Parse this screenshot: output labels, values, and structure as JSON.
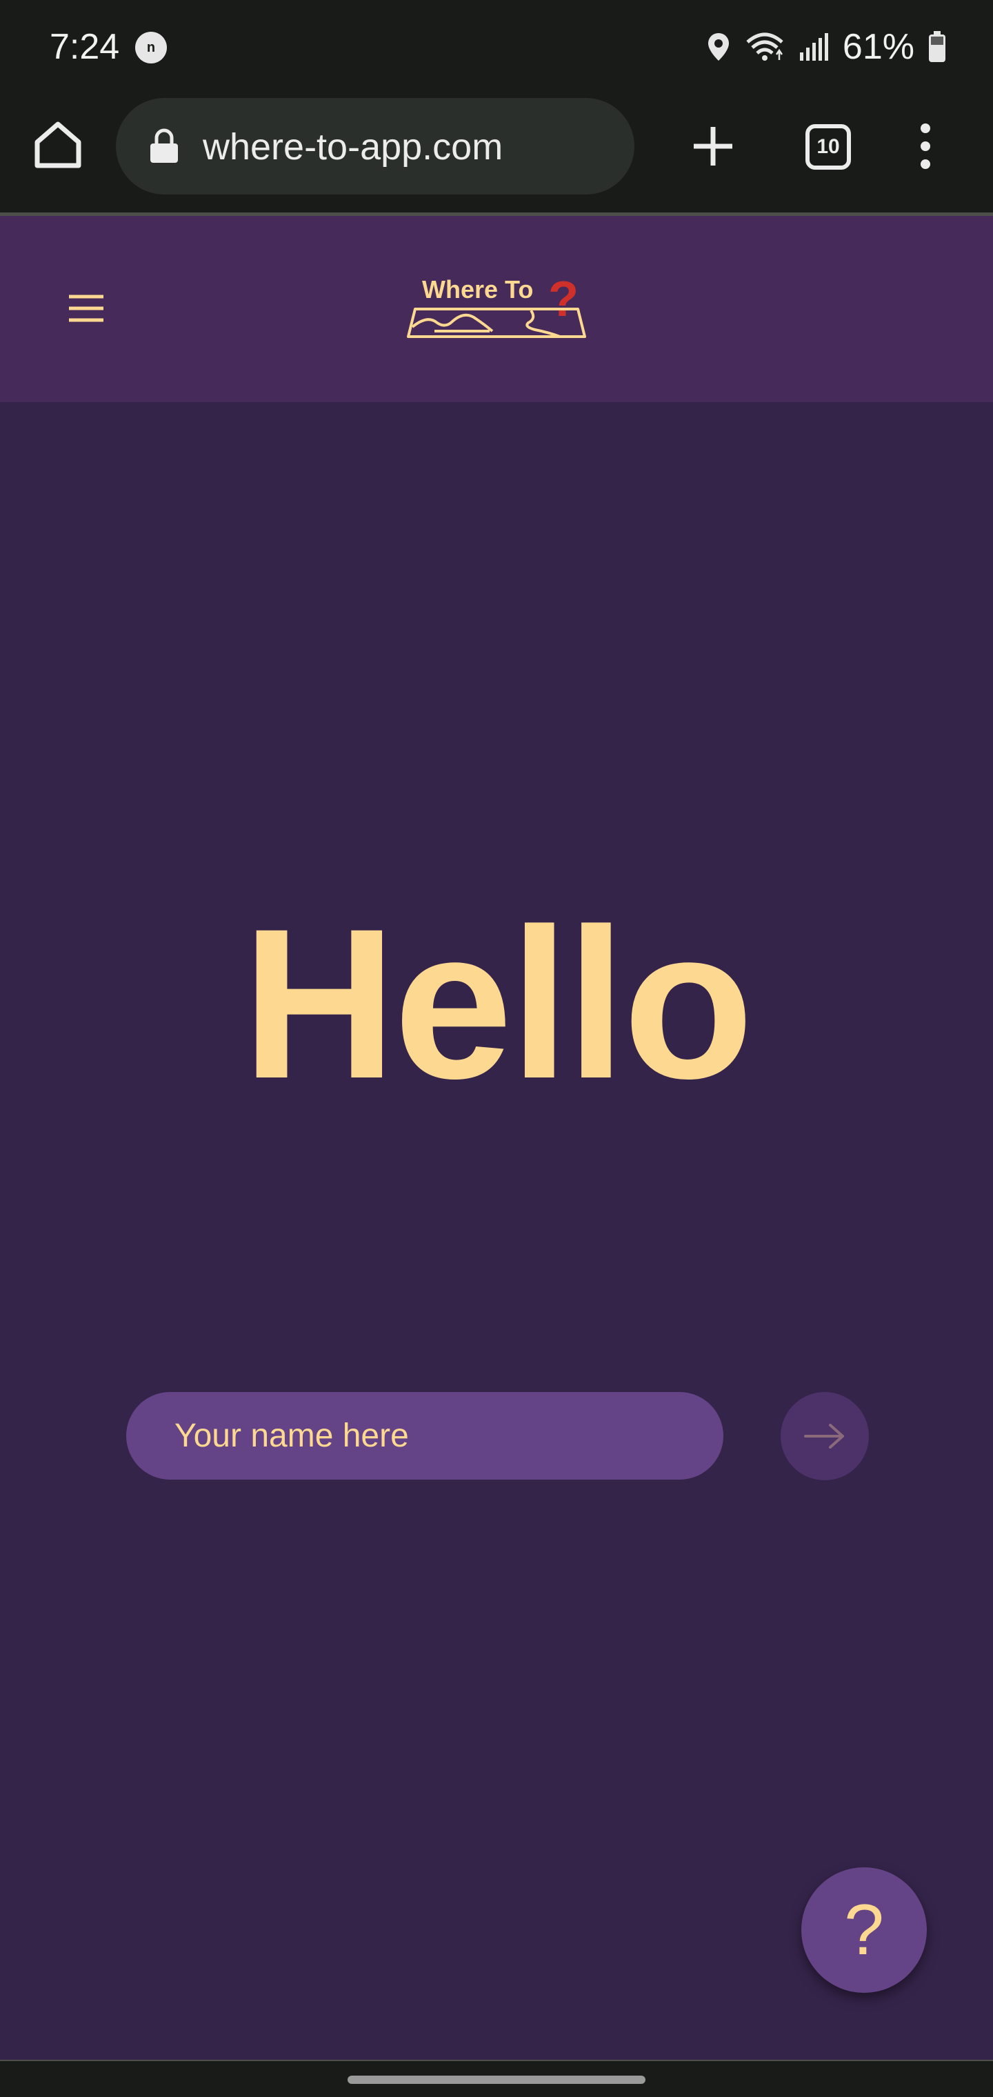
{
  "status_bar": {
    "time": "7:24",
    "notification_badge": "n",
    "battery_percent": "61%",
    "icons": [
      "location-icon",
      "wifi-icon",
      "signal-icon",
      "battery-icon"
    ]
  },
  "browser": {
    "url": "where-to-app.com",
    "tab_count": "10",
    "icons": [
      "home-icon",
      "lock-icon",
      "plus-icon",
      "tabs-icon",
      "more-vert-icon"
    ]
  },
  "header": {
    "logo_text": "Where To",
    "logo_mark": "?",
    "icons": [
      "hamburger-menu-icon",
      "map-icon"
    ]
  },
  "main": {
    "greeting": "Hello",
    "name_input": {
      "placeholder": "Your name here",
      "value": ""
    },
    "submit_icon": "arrow-right-icon"
  },
  "help_button": {
    "label": "?"
  },
  "colors": {
    "background": "#35244a",
    "header": "#452a5a",
    "accent_text": "#fdd891",
    "input_fill": "#644487",
    "logo_question_mark": "#d0302a",
    "system_bars": "#181b18"
  }
}
